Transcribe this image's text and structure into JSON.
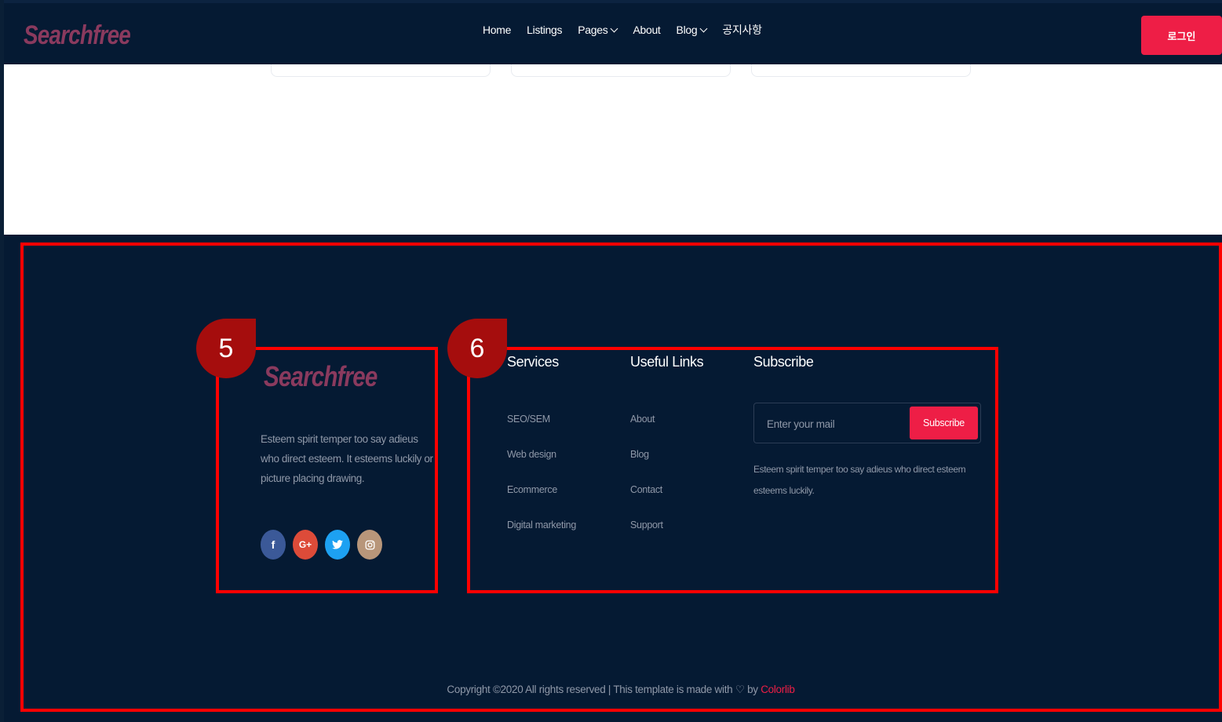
{
  "header": {
    "logo": "Searchfree",
    "nav": [
      {
        "label": "Home"
      },
      {
        "label": "Listings"
      },
      {
        "label": "Pages"
      },
      {
        "label": "About"
      },
      {
        "label": "Blog"
      },
      {
        "label": "공지사항"
      }
    ],
    "login_label": "로그인"
  },
  "footer": {
    "logo": "Searchfree",
    "description": "Esteem spirit temper too say adieus who direct esteem. It esteems luckily or picture placing drawing.",
    "social_icons": [
      "facebook-icon",
      "google-plus-icon",
      "twitter-icon",
      "instagram-icon"
    ],
    "services": {
      "title": "Services",
      "links": [
        "SEO/SEM",
        "Web design",
        "Ecommerce",
        "Digital marketing"
      ]
    },
    "useful_links": {
      "title": "Useful Links",
      "links": [
        "About",
        "Blog",
        "Contact",
        "Support"
      ]
    },
    "subscribe": {
      "title": "Subscribe",
      "placeholder": "Enter your mail",
      "button_label": "Subscribe",
      "description": "Esteem spirit temper too say adieus who direct esteem esteems luckily."
    },
    "copyright_prefix": "Copyright ©2020 All rights reserved | This template is made with",
    "copyright_by": "by",
    "copyright_brand": "Colorlib"
  },
  "annotations": {
    "marker_5": "5",
    "marker_6": "6"
  },
  "colors": {
    "accent": "#ee1e46",
    "footer_bg": "#051a33",
    "highlight": "#ff0000",
    "marker": "#a50d0d"
  }
}
